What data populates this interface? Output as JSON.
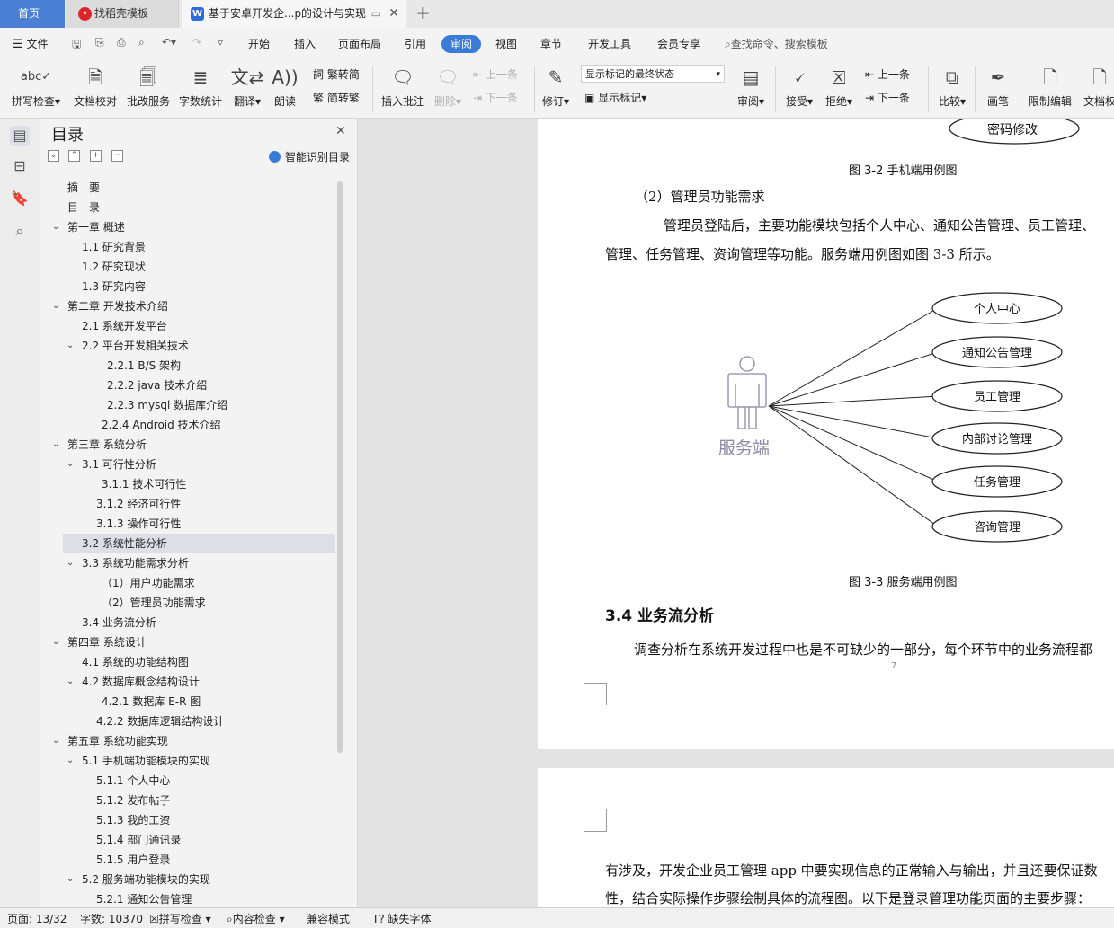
{
  "tabs": {
    "home": "首页",
    "template": "找稻壳模板",
    "document": "基于安卓开发企...p的设计与实现",
    "new_tab_icon": "plus-icon"
  },
  "menu": {
    "file": "文件",
    "items": [
      "开始",
      "插入",
      "页面布局",
      "引用",
      "审阅",
      "视图",
      "章节",
      "开发工具",
      "会员专享"
    ],
    "active": "审阅",
    "search": "查找命令、搜索模板"
  },
  "ribbon": {
    "spell": "拼写检查",
    "proof": "文档校对",
    "annotate_service": "批改服务",
    "word_count": "字数统计",
    "translate": "翻译",
    "read_aloud": "朗读",
    "trad_to_simp": "繁转简",
    "simp_to_trad": "简转繁",
    "insert_comment": "插入批注",
    "delete": "删除",
    "prev": "上一条",
    "next": "下一条",
    "revise": "修订",
    "markup_state": "显示标记的最终状态",
    "show_markup": "显示标记",
    "review": "审阅",
    "accept": "接受",
    "reject": "拒绝",
    "prev2": "上一条",
    "next2": "下一条",
    "compare": "比较",
    "pen": "画笔",
    "restrict": "限制编辑",
    "doc_perm": "文档权"
  },
  "toc": {
    "title": "目录",
    "smart": "智能识别目录",
    "items": [
      {
        "text": "摘　要",
        "level": 0
      },
      {
        "text": "目　录",
        "level": 0
      },
      {
        "text": "第一章  概述",
        "level": 0,
        "chevron": true
      },
      {
        "text": "1.1  研究背景",
        "level": 1
      },
      {
        "text": "1.2  研究现状",
        "level": 1
      },
      {
        "text": "1.3  研究内容",
        "level": 1
      },
      {
        "text": " 第二章  开发技术介绍",
        "level": 0,
        "chevron": true
      },
      {
        "text": "2.1    系统开发平台",
        "level": 1
      },
      {
        "text": "2.2  平台开发相关技术",
        "level": 1,
        "chevron": true
      },
      {
        "text": "2.2.1    B/S 架构",
        "level": 2
      },
      {
        "text": "2.2.2    java 技术介绍",
        "level": 2
      },
      {
        "text": "2.2.3 mysql 数据库介绍",
        "level": 2
      },
      {
        "text": "2.2.4 Android 技术介绍",
        "level": 3
      },
      {
        "text": "第三章  系统分析",
        "level": 0,
        "chevron": true
      },
      {
        "text": "3.1  可行性分析",
        "level": 1,
        "chevron": true
      },
      {
        "text": "3.1.1    技术可行性",
        "level": 4
      },
      {
        "text": "3.1.2  经济可行性",
        "level": 5
      },
      {
        "text": "3.1.3  操作可行性",
        "level": 5
      },
      {
        "text": "3.2  系统性能分析",
        "level": 1
      },
      {
        "text": "3.3  系统功能需求分析",
        "level": 1,
        "chevron": true
      },
      {
        "text": "（1）用户功能需求",
        "level": 6
      },
      {
        "text": "（2）管理员功能需求",
        "level": 6
      },
      {
        "text": "3.4  业务流分析",
        "level": 1
      },
      {
        "text": "第四章  系统设计",
        "level": 0,
        "chevron": true
      },
      {
        "text": "4.1  系统的功能结构图",
        "level": 1
      },
      {
        "text": "4.2  数据库概念结构设计",
        "level": 1,
        "chevron": true
      },
      {
        "text": "4.2.1    数据库 E-R 图",
        "level": 3
      },
      {
        "text": "4.2.2  数据库逻辑结构设计",
        "level": 5
      },
      {
        "text": "第五章  系统功能实现",
        "level": 0,
        "chevron": true
      },
      {
        "text": "5.1  手机端功能模块的实现",
        "level": 1,
        "chevron": true
      },
      {
        "text": "5.1.1 个人中心",
        "level": 5
      },
      {
        "text": "5.1.2 发布帖子",
        "level": 5
      },
      {
        "text": "5.1.3 我的工资",
        "level": 5
      },
      {
        "text": "5.1.4 部门通讯录",
        "level": 5
      },
      {
        "text": "5.1.5 用户登录",
        "level": 5
      },
      {
        "text": "5.2 服务端功能模块的实现",
        "level": 1,
        "chevron": true
      },
      {
        "text": "5.2.1 通知公告管理",
        "level": 5
      }
    ],
    "selected": "3.2  系统性能分析"
  },
  "document": {
    "prev_node": "密码修改",
    "fig_3_2": "图 3-2  手机端用例图",
    "sub_heading": "（2）管理员功能需求",
    "para1_line1": "管理员登陆后，主要功能模块包括个人中心、通知公告管理、员工管理、",
    "para1_line2": "管理、任务管理、资询管理等功能。服务端用例图如图 3-3 所示。",
    "actor": "服务端",
    "use_cases": [
      "个人中心",
      "通知公告管理",
      "员工管理",
      "内部讨论管理",
      "任务管理",
      "咨询管理"
    ],
    "fig_3_3": "图 3-3  服务端用例图",
    "section_heading": "3.4  业务流分析",
    "para2": "调查分析在系统开发过程中也是不可缺少的一部分，每个环节中的业务流程都",
    "page_number": "7",
    "page2_line1": "有涉及，开发企业员工管理 app 中要实现信息的正常输入与输出，并且还要保证数",
    "page2_line2": "性，结合实际操作步骤绘制具体的流程图。以下是登录管理功能页面的主要步骤："
  },
  "status": {
    "page": "页面: 13/32",
    "words": "字数: 10370",
    "spell": "拼写检查",
    "content": "内容检查",
    "compat": "兼容模式",
    "missing_font": "缺失字体"
  }
}
